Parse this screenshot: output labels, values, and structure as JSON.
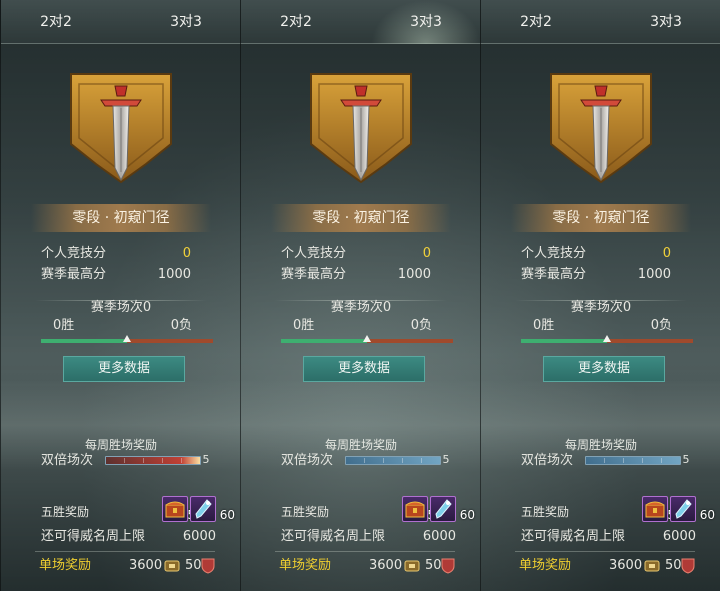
{
  "panels": [
    {
      "tabs": {
        "left": "2对2",
        "right": "3对3",
        "active": "none"
      },
      "rank": "零段 · 初窥门径",
      "score_label": "个人竞技分",
      "score_value": "0",
      "best_label": "赛季最高分",
      "best_value": "1000",
      "season_matches": "赛季场次0",
      "wins": "0胜",
      "losses": "0负",
      "win_ratio": 0.5,
      "more_button": "更多数据",
      "weekly_title": "每周胜场奖励",
      "double_label": "双倍场次",
      "double_count": "5",
      "double_bar_style": "red",
      "five_win_label": "五胜奖励",
      "item_counts": [
        "5",
        "60"
      ],
      "fame_label": "还可得威名周上限",
      "fame_value": "6000",
      "single_label": "单场奖励",
      "single_reward_a": "3600",
      "single_reward_b": "50"
    },
    {
      "tabs": {
        "left": "2对2",
        "right": "3对3",
        "active": "right"
      },
      "rank": "零段 · 初窥门径",
      "score_label": "个人竞技分",
      "score_value": "0",
      "best_label": "赛季最高分",
      "best_value": "1000",
      "season_matches": "赛季场次0",
      "wins": "0胜",
      "losses": "0负",
      "win_ratio": 0.5,
      "more_button": "更多数据",
      "weekly_title": "每周胜场奖励",
      "double_label": "双倍场次",
      "double_count": "5",
      "double_bar_style": "blue",
      "five_win_label": "五胜奖励",
      "item_counts": [
        "5",
        "60"
      ],
      "fame_label": "还可得威名周上限",
      "fame_value": "6000",
      "single_label": "单场奖励",
      "single_reward_a": "3600",
      "single_reward_b": "50"
    },
    {
      "tabs": {
        "left": "2对2",
        "right": "3对3",
        "active": "none"
      },
      "rank": "零段 · 初窥门径",
      "score_label": "个人竞技分",
      "score_value": "0",
      "best_label": "赛季最高分",
      "best_value": "1000",
      "season_matches": "赛季场次0",
      "wins": "0胜",
      "losses": "0负",
      "win_ratio": 0.5,
      "more_button": "更多数据",
      "weekly_title": "每周胜场奖励",
      "double_label": "双倍场次",
      "double_count": "5",
      "double_bar_style": "blue",
      "five_win_label": "五胜奖励",
      "item_counts": [
        "5",
        "60"
      ],
      "fame_label": "还可得威名周上限",
      "fame_value": "6000",
      "single_label": "单场奖励",
      "single_reward_a": "3600",
      "single_reward_b": "50"
    }
  ],
  "colors": {
    "score_yellow": "#f2d23a",
    "single_reward_gold": "#f0cf30",
    "win_green": "#3eaf70",
    "loss_red": "#a04a2c",
    "button_teal": "#2c6e68"
  },
  "icons": [
    "sword-banner-emblem-icon",
    "treasure-chest-icon",
    "jade-charm-icon",
    "coin-icon",
    "shield-icon"
  ]
}
